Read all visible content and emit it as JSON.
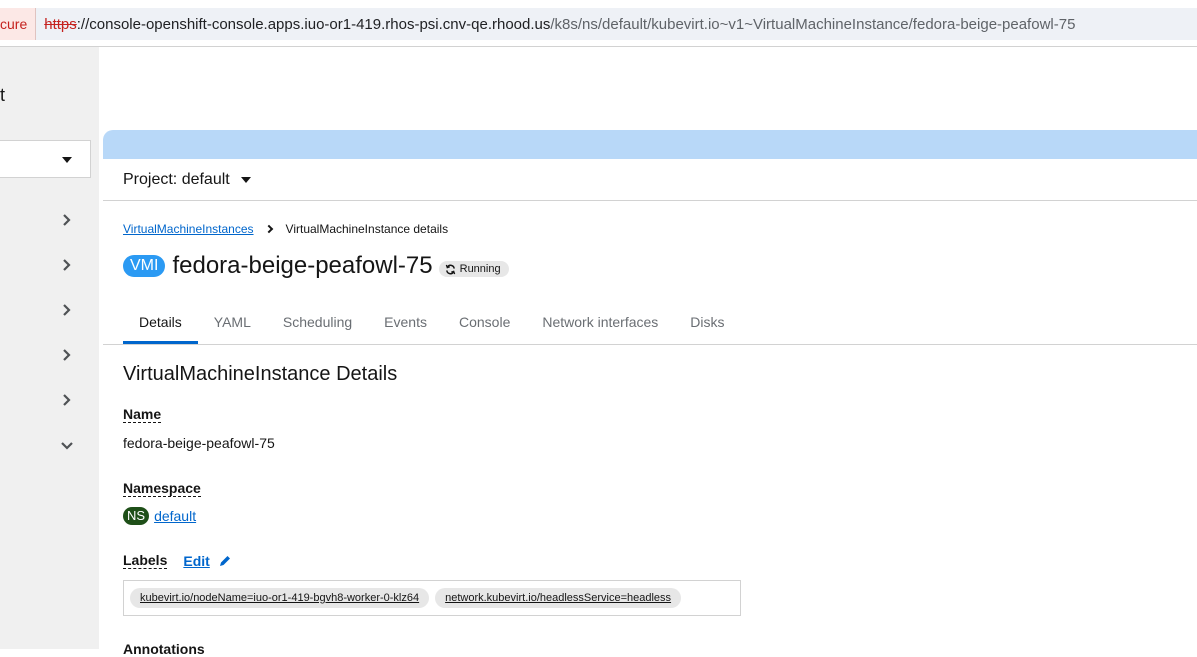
{
  "urlbar": {
    "security_label": "cure",
    "scheme": "https",
    "host": "://console-openshift-console.apps.iuo-or1-419.rhos-psi.cnv-qe.rhood.us",
    "path": "/k8s/ns/default/kubevirt.io~v1~VirtualMachineInstance/fedora-beige-peafowl-75"
  },
  "sidebar": {
    "title_fragment": "t"
  },
  "project": {
    "label": "Project: default"
  },
  "breadcrumb": {
    "parent": "VirtualMachineInstances",
    "current": "VirtualMachineInstance details"
  },
  "resource": {
    "badge": "VMI",
    "name": "fedora-beige-peafowl-75",
    "status": "Running"
  },
  "tabs": [
    {
      "label": "Details"
    },
    {
      "label": "YAML"
    },
    {
      "label": "Scheduling"
    },
    {
      "label": "Events"
    },
    {
      "label": "Console"
    },
    {
      "label": "Network interfaces"
    },
    {
      "label": "Disks"
    }
  ],
  "details": {
    "section_title": "VirtualMachineInstance Details",
    "name_label": "Name",
    "name_value": "fedora-beige-peafowl-75",
    "namespace_label": "Namespace",
    "namespace_badge": "NS",
    "namespace_value": "default",
    "labels_label": "Labels",
    "edit_label": "Edit",
    "labels": [
      "kubevirt.io/nodeName=iuo-or1-419-bgvh8-worker-0-klz64",
      "network.kubevirt.io/headlessService=headless"
    ],
    "annotations_label": "Annotations"
  },
  "colors": {
    "accent": "#0066cc",
    "vmi_badge": "#2b9af3",
    "ns_badge": "#1e4f18",
    "banner": "#b8d8f8"
  }
}
